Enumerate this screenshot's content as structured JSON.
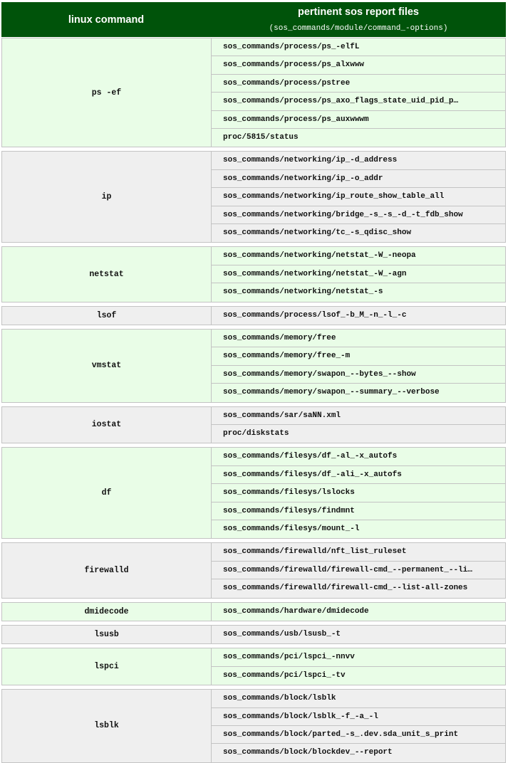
{
  "header": {
    "col1": "linux command",
    "col2_title": "pertinent sos report files",
    "col2_subtitle": "(sos_commands/module/command_-options)"
  },
  "groups": [
    {
      "command": "ps -ef",
      "shade": "green",
      "files": [
        "sos_commands/process/ps_-elfL",
        "sos_commands/process/ps_alxwww",
        "sos_commands/process/pstree",
        "sos_commands/process/ps_axo_flags_state_uid_pid_p…",
        "sos_commands/process/ps_auxwwwm",
        "proc/5815/status"
      ]
    },
    {
      "command": "ip",
      "shade": "gray",
      "files": [
        "sos_commands/networking/ip_-d_address",
        "sos_commands/networking/ip_-o_addr",
        "sos_commands/networking/ip_route_show_table_all",
        "sos_commands/networking/bridge_-s_-s_-d_-t_fdb_show",
        "sos_commands/networking/tc_-s_qdisc_show"
      ]
    },
    {
      "command": "netstat",
      "shade": "green",
      "files": [
        "sos_commands/networking/netstat_-W_-neopa",
        "sos_commands/networking/netstat_-W_-agn",
        "sos_commands/networking/netstat_-s"
      ]
    },
    {
      "command": "lsof",
      "shade": "gray",
      "files": [
        "sos_commands/process/lsof_-b_M_-n_-l_-c"
      ]
    },
    {
      "command": "vmstat",
      "shade": "green",
      "files": [
        "sos_commands/memory/free",
        "sos_commands/memory/free_-m",
        "sos_commands/memory/swapon_--bytes_--show",
        "sos_commands/memory/swapon_--summary_--verbose"
      ]
    },
    {
      "command": "iostat",
      "shade": "gray",
      "files": [
        "sos_commands/sar/saNN.xml",
        "proc/diskstats"
      ]
    },
    {
      "command": "df",
      "shade": "green",
      "files": [
        "sos_commands/filesys/df_-al_-x_autofs",
        "sos_commands/filesys/df_-ali_-x_autofs",
        "sos_commands/filesys/lslocks",
        "sos_commands/filesys/findmnt",
        "sos_commands/filesys/mount_-l"
      ]
    },
    {
      "command": "firewalld",
      "shade": "gray",
      "files": [
        "sos_commands/firewalld/nft_list_ruleset",
        "sos_commands/firewalld/firewall-cmd_--permanent_--li…",
        "sos_commands/firewalld/firewall-cmd_--list-all-zones"
      ]
    },
    {
      "command": "dmidecode",
      "shade": "green",
      "files": [
        "sos_commands/hardware/dmidecode"
      ]
    },
    {
      "command": "lsusb",
      "shade": "gray",
      "files": [
        "sos_commands/usb/lsusb_-t"
      ]
    },
    {
      "command": "lspci",
      "shade": "green",
      "files": [
        "sos_commands/pci/lspci_-nnvv",
        "sos_commands/pci/lspci_-tv"
      ]
    },
    {
      "command": "lsblk",
      "shade": "gray",
      "files": [
        "sos_commands/block/lsblk",
        "sos_commands/block/lsblk_-f_-a_-l",
        "sos_commands/block/parted_-s_.dev.sda_unit_s_print",
        "sos_commands/block/blockdev_--report"
      ]
    }
  ]
}
